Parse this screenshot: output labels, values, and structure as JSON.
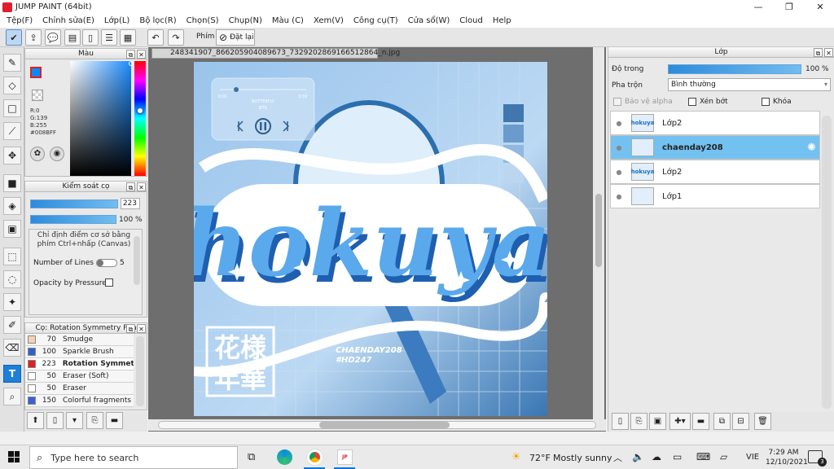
{
  "window": {
    "title": "JUMP PAINT (64bit)",
    "min": "—",
    "max": "❐",
    "close": "✕"
  },
  "menu": [
    "Tệp(F)",
    "Chỉnh sửa(E)",
    "Lớp(L)",
    "Bộ lọc(R)",
    "Chọn(S)",
    "Chụp(N)",
    "Màu (C)",
    "Xem(V)",
    "Công cụ(T)",
    "Cửa sổ(W)",
    "Cloud",
    "Help"
  ],
  "toolbar": {
    "shortcut_label": "Phím",
    "reset_label": "Đặt lại"
  },
  "color_panel": {
    "title": "Màu",
    "r": "R:0",
    "g": "G:139",
    "b": "B:255",
    "hex": "#008BFF",
    "fg_color": "#008BFF"
  },
  "brush_control": {
    "title": "Kiểm soát cọ",
    "size": "223",
    "opacity": "100 %",
    "opacity_value": 1.0,
    "hint": "Chỉ định điểm cơ sở bằng phím Ctrl+nhấp (Canvas)",
    "lines_label": "Number of Lines",
    "lines_value": "5",
    "pressure_label": "Opacity by Pressure"
  },
  "brush_list": {
    "title": "Cọ: Rotation Symmetry Pen",
    "items": [
      {
        "size": "70",
        "name": "Smudge",
        "color": "#f3d3b3"
      },
      {
        "size": "100",
        "name": "Sparkle Brush",
        "color": "#2f5fd8"
      },
      {
        "size": "223",
        "name": "Rotation Symmet",
        "color": "#e22020"
      },
      {
        "size": "50",
        "name": "Eraser (Soft)",
        "color": "#ffffff"
      },
      {
        "size": "50",
        "name": "Eraser",
        "color": "#ffffff"
      },
      {
        "size": "150",
        "name": "Colorful fragments",
        "color": "#3a5ee0"
      }
    ]
  },
  "canvas": {
    "doc_tab": "248341907_866205904089673_7329202869166512864_n.jpg"
  },
  "artwork": {
    "player_time_start": "0:01",
    "player_time_end": "3:59",
    "song": "BUTTERFLY",
    "artist": "BTS",
    "main_text": "hokuya",
    "credit_1": "CHAENDAY208",
    "credit_2": "#HD247",
    "cjk_1": "花様",
    "cjk_2": "年華"
  },
  "layer_panel": {
    "title": "Lớp",
    "opacity_label": "Độ trong",
    "opacity_value": "100 %",
    "opacity_fraction": 1.0,
    "blend_label": "Pha trộn",
    "blend_value": "Bình thường",
    "protect_alpha": "Bảo vệ alpha",
    "clipping": "Xén bớt",
    "lock": "Khóa",
    "layers": [
      {
        "name": "Lớp2",
        "thumb": "hokuya",
        "selected": false
      },
      {
        "name": "chaenday208",
        "thumb": "",
        "selected": true
      },
      {
        "name": "Lớp2",
        "thumb": "hokuya",
        "selected": false
      },
      {
        "name": "Lớp1",
        "thumb": "",
        "selected": false
      }
    ]
  },
  "taskbar": {
    "search_placeholder": "Type here to search",
    "weather_temp": "72°F",
    "weather_desc": "Mostly sunny",
    "lang": "VIE",
    "time": "7:29 AM",
    "date": "12/10/2021",
    "notif_count": "3"
  }
}
